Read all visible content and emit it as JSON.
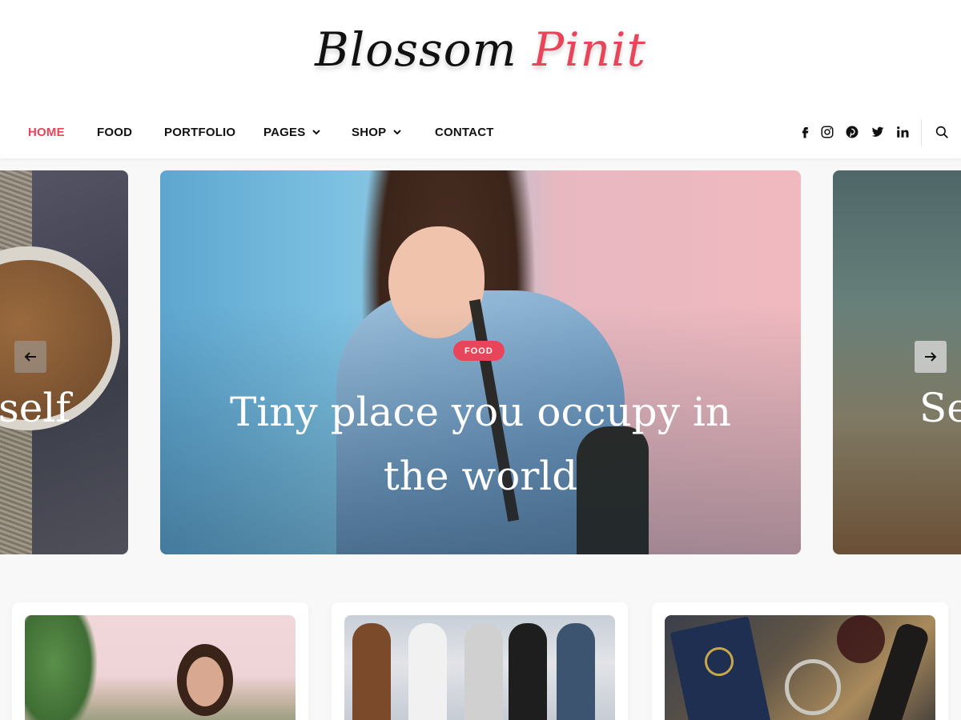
{
  "header": {
    "logo_part1": "Blossom",
    "logo_part2": "Pinit",
    "accent_color": "#e8445a"
  },
  "nav": {
    "items": [
      {
        "label": "HOME",
        "active": true
      },
      {
        "label": "FOOD",
        "active": false
      },
      {
        "label": "PORTFOLIO",
        "active": false
      },
      {
        "label": "PAGES",
        "active": false,
        "dropdown": true
      },
      {
        "label": "SHOP",
        "active": false,
        "dropdown": true
      },
      {
        "label": "CONTACT",
        "active": false
      }
    ]
  },
  "social": {
    "icons": [
      "facebook-icon",
      "instagram-icon",
      "pinterest-icon",
      "twitter-icon",
      "linkedin-icon"
    ],
    "search_icon": "search-icon"
  },
  "slider": {
    "left_caption": "n self",
    "main": {
      "category": "FOOD",
      "title": "Tiny place you occupy in the world"
    },
    "right_caption": "Se",
    "prev_icon": "arrow-left-icon",
    "next_icon": "arrow-right-icon"
  },
  "cards": [
    {
      "image": "woman-outdoors"
    },
    {
      "image": "shopping-group"
    },
    {
      "image": "travel-passport-map"
    }
  ]
}
